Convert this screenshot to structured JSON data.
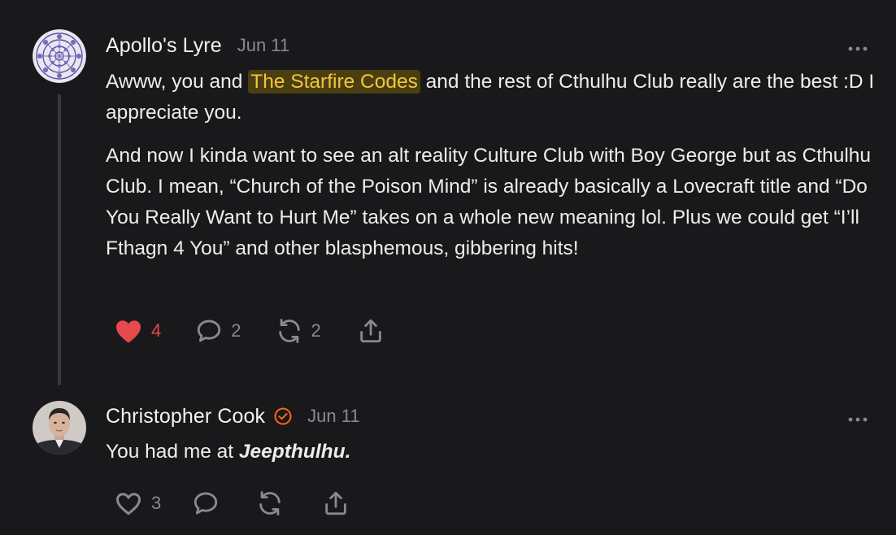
{
  "comments": [
    {
      "author": "Apollo's Lyre",
      "date": "Jun 11",
      "verified": false,
      "body_1_pre": "Awww, you and ",
      "mention": "The Starfire Codes",
      "body_1_post": " and the rest of Cthulhu Club really are the best :D I appreciate you.",
      "body_2": "And now I kinda want to see an alt reality Culture Club with Boy George but as Cthulhu Club. I mean, “Church of the Poison Mind” is already basically a Lovecraft title and “Do You Really Want to Hurt Me” takes on a whole new meaning lol. Plus we could get “I’ll Fthagn 4 You” and other blasphemous, gibbering hits!",
      "likes": "4",
      "liked": true,
      "replies": "2",
      "restacks": "2"
    },
    {
      "author": "Christopher Cook",
      "date": "Jun 11",
      "verified": true,
      "body_pre": "You had me at ",
      "body_emph": "Jeepthulhu.",
      "likes": "3",
      "liked": false,
      "replies": "",
      "restacks": ""
    }
  ],
  "colors": {
    "background": "#19191b",
    "like_active": "#e5484d",
    "mention_text": "#f2c53d",
    "mention_bg": "#4a3f10",
    "verified_badge": "#ff6719",
    "muted": "#8a8a8e"
  },
  "icons": [
    "avatar-pattern",
    "heart-icon",
    "comment-icon",
    "restack-icon",
    "share-icon",
    "more-icon",
    "verified-badge-icon"
  ]
}
